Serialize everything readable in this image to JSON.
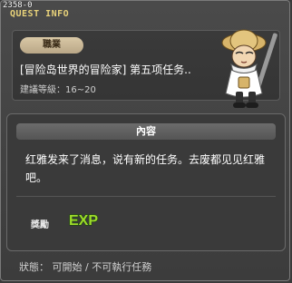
{
  "window": {
    "id": "2358-0",
    "title": "QUEST INFO"
  },
  "quest": {
    "job": "職業",
    "name": "[冒险岛世界的冒险家] 第五项任务..",
    "level": "建議等級：16~20"
  },
  "content": {
    "header": "內容",
    "text": "红雅发来了消息，说有新的任务。去废都见见红雅吧。"
  },
  "reward": {
    "label": "獎勵",
    "icon": "exp-icon",
    "icon_text": "EXP"
  },
  "status": {
    "text": "狀態： 可開始 / 不可執行任務"
  },
  "colors": {
    "title": "#e8d27a",
    "exp_fill": "#9edb2a",
    "exp_stroke": "#1f4a0f"
  }
}
